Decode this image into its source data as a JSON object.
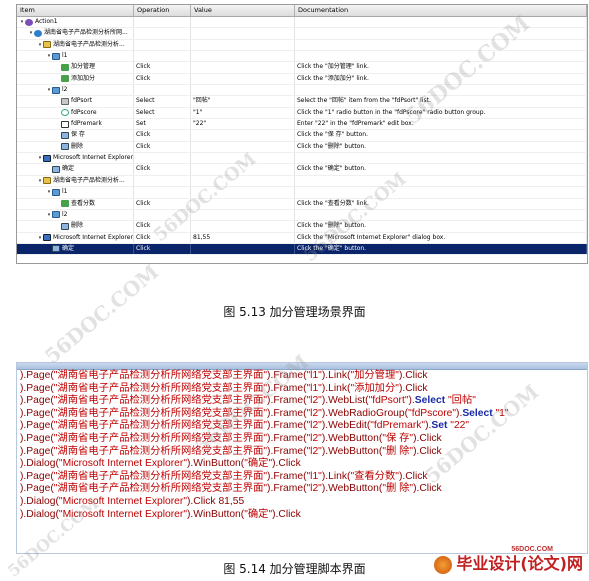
{
  "keyword_view": {
    "columns": [
      "Item",
      "Operation",
      "Value",
      "Documentation"
    ],
    "rows": [
      {
        "level": 0,
        "expand": "▾",
        "icon": "action",
        "item": "Action1",
        "op": "",
        "val": "",
        "doc": ""
      },
      {
        "level": 1,
        "expand": "▾",
        "icon": "browser",
        "item": "湖南省电子产品检测分析所网...",
        "op": "",
        "val": "",
        "doc": ""
      },
      {
        "level": 2,
        "expand": "▾",
        "icon": "page",
        "item": "湖南省电子产品检测分析...",
        "op": "",
        "val": "",
        "doc": ""
      },
      {
        "level": 3,
        "expand": "▾",
        "icon": "frame",
        "item": "l1",
        "op": "",
        "val": "",
        "doc": ""
      },
      {
        "level": 4,
        "expand": "",
        "icon": "link",
        "item": "加分管理",
        "op": "Click",
        "val": "",
        "doc": "Click the \"加分管理\" link."
      },
      {
        "level": 4,
        "expand": "",
        "icon": "link",
        "item": "添加加分",
        "op": "Click",
        "val": "",
        "doc": "Click the \"添加加分\" link."
      },
      {
        "level": 3,
        "expand": "▾",
        "icon": "frame",
        "item": "l2",
        "op": "",
        "val": "",
        "doc": ""
      },
      {
        "level": 4,
        "expand": "",
        "icon": "list",
        "item": "fdPsort",
        "op": "Select",
        "val": "\"回帖\"",
        "doc": "Select the \"回帖\" item from the \"fdPsort\" list."
      },
      {
        "level": 4,
        "expand": "",
        "icon": "radio",
        "item": "fdPscore",
        "op": "Select",
        "val": "\"1\"",
        "doc": "Click the \"1\" radio button in the \"fdPscore\" radio button group."
      },
      {
        "level": 4,
        "expand": "",
        "icon": "edit",
        "item": "fdPremark",
        "op": "Set",
        "val": "\"22\"",
        "doc": "Enter \"22\" in the \"fdPremark\" edit box."
      },
      {
        "level": 4,
        "expand": "",
        "icon": "btn",
        "item": "保 存",
        "op": "Click",
        "val": "",
        "doc": "Click the \"保 存\" button."
      },
      {
        "level": 4,
        "expand": "",
        "icon": "btn",
        "item": "删除",
        "op": "Click",
        "val": "",
        "doc": "Click the \"删除\" button."
      },
      {
        "level": 2,
        "expand": "▾",
        "icon": "dialog",
        "item": "Microsoft Internet Explorer",
        "op": "",
        "val": "",
        "doc": ""
      },
      {
        "level": 3,
        "expand": "",
        "icon": "btn",
        "item": "确定",
        "op": "Click",
        "val": "",
        "doc": "Click the \"确定\" button."
      },
      {
        "level": 2,
        "expand": "▾",
        "icon": "page",
        "item": "湖南省电子产品检测分析...",
        "op": "",
        "val": "",
        "doc": ""
      },
      {
        "level": 3,
        "expand": "▾",
        "icon": "frame",
        "item": "l1",
        "op": "",
        "val": "",
        "doc": ""
      },
      {
        "level": 4,
        "expand": "",
        "icon": "link",
        "item": "查看分数",
        "op": "Click",
        "val": "",
        "doc": "Click the \"查看分数\" link."
      },
      {
        "level": 3,
        "expand": "▾",
        "icon": "frame",
        "item": "l2",
        "op": "",
        "val": "",
        "doc": ""
      },
      {
        "level": 4,
        "expand": "",
        "icon": "btn",
        "item": "删除",
        "op": "Click",
        "val": "",
        "doc": "Click the \"删除\" button."
      },
      {
        "level": 2,
        "expand": "▾",
        "icon": "dialog",
        "item": "Microsoft Internet Explorer",
        "op": "Click",
        "val": "81,55",
        "doc": "Click the \"Microsoft Internet Explorer\" dialog box."
      },
      {
        "level": 3,
        "expand": "",
        "icon": "btn",
        "item": "确定",
        "op": "Click",
        "val": "",
        "doc": "Click the \"确定\" button.",
        "selected": true
      }
    ]
  },
  "caption_top": "图 5.13   加分管理场景界面",
  "expert_view": {
    "lines": [
      [
        [
          "p",
          ")."
        ],
        [
          "p",
          "Page("
        ],
        [
          "s",
          "\"湖南省电子产品检测分析所网络党支部主界面\""
        ],
        [
          "p",
          ").Frame("
        ],
        [
          "s",
          "\"l1\""
        ],
        [
          "p",
          ").Link("
        ],
        [
          "s",
          "\"加分管理\""
        ],
        [
          "p",
          ").Click"
        ]
      ],
      [
        [
          "p",
          ")."
        ],
        [
          "p",
          "Page("
        ],
        [
          "s",
          "\"湖南省电子产品检测分析所网络党支部主界面\""
        ],
        [
          "p",
          ").Frame("
        ],
        [
          "s",
          "\"l1\""
        ],
        [
          "p",
          ").Link("
        ],
        [
          "s",
          "\"添加加分\""
        ],
        [
          "p",
          ").Click"
        ]
      ],
      [
        [
          "p",
          ")."
        ],
        [
          "p",
          "Page("
        ],
        [
          "s",
          "\"湖南省电子产品检测分析所网络党支部主界面\""
        ],
        [
          "p",
          ").Frame("
        ],
        [
          "s",
          "\"l2\""
        ],
        [
          "p",
          ").WebList("
        ],
        [
          "s",
          "\"fdPsort\""
        ],
        [
          "p",
          ")."
        ],
        [
          "k",
          "Select"
        ],
        [
          "s",
          " \"回帖\""
        ]
      ],
      [
        [
          "p",
          ")."
        ],
        [
          "p",
          "Page("
        ],
        [
          "s",
          "\"湖南省电子产品检测分析所网络党支部主界面\""
        ],
        [
          "p",
          ").Frame("
        ],
        [
          "s",
          "\"l2\""
        ],
        [
          "p",
          ").WebRadioGroup("
        ],
        [
          "s",
          "\"fdPscore\""
        ],
        [
          "p",
          ")."
        ],
        [
          "k",
          "Select"
        ],
        [
          "s",
          " \"1\""
        ]
      ],
      [
        [
          "p",
          ")."
        ],
        [
          "p",
          "Page("
        ],
        [
          "s",
          "\"湖南省电子产品检测分析所网络党支部主界面\""
        ],
        [
          "p",
          ").Frame("
        ],
        [
          "s",
          "\"l2\""
        ],
        [
          "p",
          ").WebEdit("
        ],
        [
          "s",
          "\"fdPremark\""
        ],
        [
          "p",
          ")."
        ],
        [
          "k",
          "Set"
        ],
        [
          "s",
          " \"22\""
        ]
      ],
      [
        [
          "p",
          ")."
        ],
        [
          "p",
          "Page("
        ],
        [
          "s",
          "\"湖南省电子产品检测分析所网络党支部主界面\""
        ],
        [
          "p",
          ").Frame("
        ],
        [
          "s",
          "\"l2\""
        ],
        [
          "p",
          ").WebButton("
        ],
        [
          "s",
          "\"保 存\""
        ],
        [
          "p",
          ").Click"
        ]
      ],
      [
        [
          "p",
          ")."
        ],
        [
          "p",
          "Page("
        ],
        [
          "s",
          "\"湖南省电子产品检测分析所网络党支部主界面\""
        ],
        [
          "p",
          ").Frame("
        ],
        [
          "s",
          "\"l2\""
        ],
        [
          "p",
          ").WebButton("
        ],
        [
          "s",
          "\"删 除\""
        ],
        [
          "p",
          ").Click"
        ]
      ],
      [
        [
          "p",
          ")."
        ],
        [
          "p",
          "Dialog("
        ],
        [
          "s",
          "\"Microsoft Internet Explorer\""
        ],
        [
          "p",
          ").WinButton("
        ],
        [
          "s",
          "\"确定\""
        ],
        [
          "p",
          ").Click"
        ]
      ],
      [
        [
          "p",
          ")."
        ],
        [
          "p",
          "Page("
        ],
        [
          "s",
          "\"湖南省电子产品检测分析所网络党支部主界面\""
        ],
        [
          "p",
          ").Frame("
        ],
        [
          "s",
          "\"l1\""
        ],
        [
          "p",
          ").Link("
        ],
        [
          "s",
          "\"查看分数\""
        ],
        [
          "p",
          ").Click"
        ]
      ],
      [
        [
          "p",
          ")."
        ],
        [
          "p",
          "Page("
        ],
        [
          "s",
          "\"湖南省电子产品检测分析所网络党支部主界面\""
        ],
        [
          "p",
          ").Frame("
        ],
        [
          "s",
          "\"l2\""
        ],
        [
          "p",
          ").WebButton("
        ],
        [
          "s",
          "\"删 除\""
        ],
        [
          "p",
          ").Click"
        ]
      ],
      [
        [
          "p",
          ")."
        ],
        [
          "p",
          "Dialog("
        ],
        [
          "s",
          "\"Microsoft Internet Explorer\""
        ],
        [
          "p",
          ").Click 81,55"
        ]
      ],
      [
        [
          "p",
          ")."
        ],
        [
          "p",
          "Dialog("
        ],
        [
          "s",
          "\"Microsoft Internet Explorer\""
        ],
        [
          "p",
          ").WinButton("
        ],
        [
          "s",
          "\"确定\""
        ],
        [
          "p",
          ").Click"
        ]
      ]
    ]
  },
  "caption_bottom": "图 5.14   加分管理脚本界面",
  "watermark": "56DOC.COM",
  "brand": {
    "url": "56DOC.COM",
    "text": "毕业设计(论文)网"
  }
}
